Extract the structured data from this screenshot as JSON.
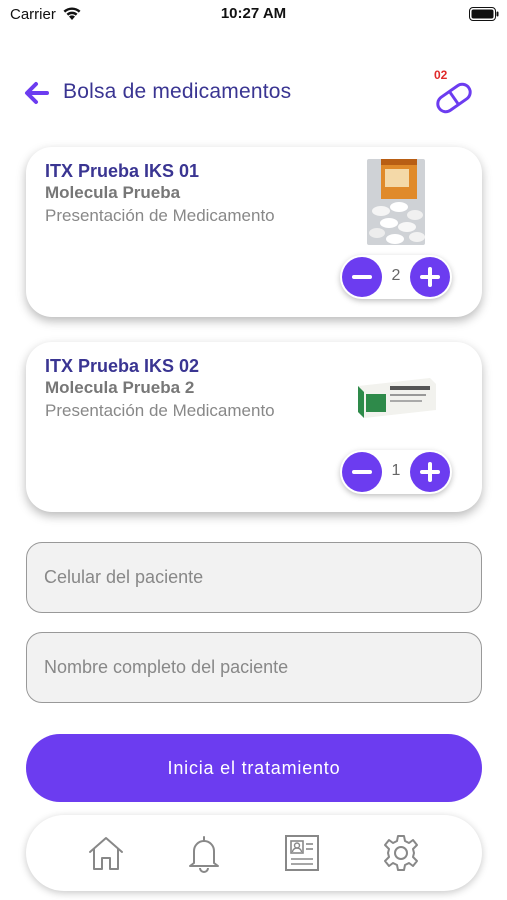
{
  "status_bar": {
    "carrier": "Carrier",
    "time": "10:27 AM"
  },
  "header": {
    "title": "Bolsa de medicamentos",
    "back_icon": "arrow-left-icon",
    "bag_count": "02",
    "bag_icon": "pill-capsule-icon"
  },
  "medications": [
    {
      "name": "ITX Prueba IKS 01",
      "molecule": "Molecula Prueba",
      "presentation": "Presentación de Medicamento",
      "image": "pills-bottle-photo",
      "quantity": "2"
    },
    {
      "name": "ITX Prueba IKS 02",
      "molecule": "Molecula Prueba 2",
      "presentation": "Presentación de Medicamento",
      "image": "medicine-box-photo",
      "quantity": "1"
    }
  ],
  "form": {
    "phone_placeholder": "Celular del paciente",
    "name_placeholder": "Nombre completo del paciente"
  },
  "actions": {
    "start_treatment": "Inicia el tratamiento"
  },
  "bottom_nav": {
    "items": [
      "home-icon",
      "bell-icon",
      "profile-card-icon",
      "gear-icon"
    ]
  },
  "colors": {
    "accent": "#6c3cf0",
    "title": "#3a3592",
    "badge": "#e02a2a"
  }
}
